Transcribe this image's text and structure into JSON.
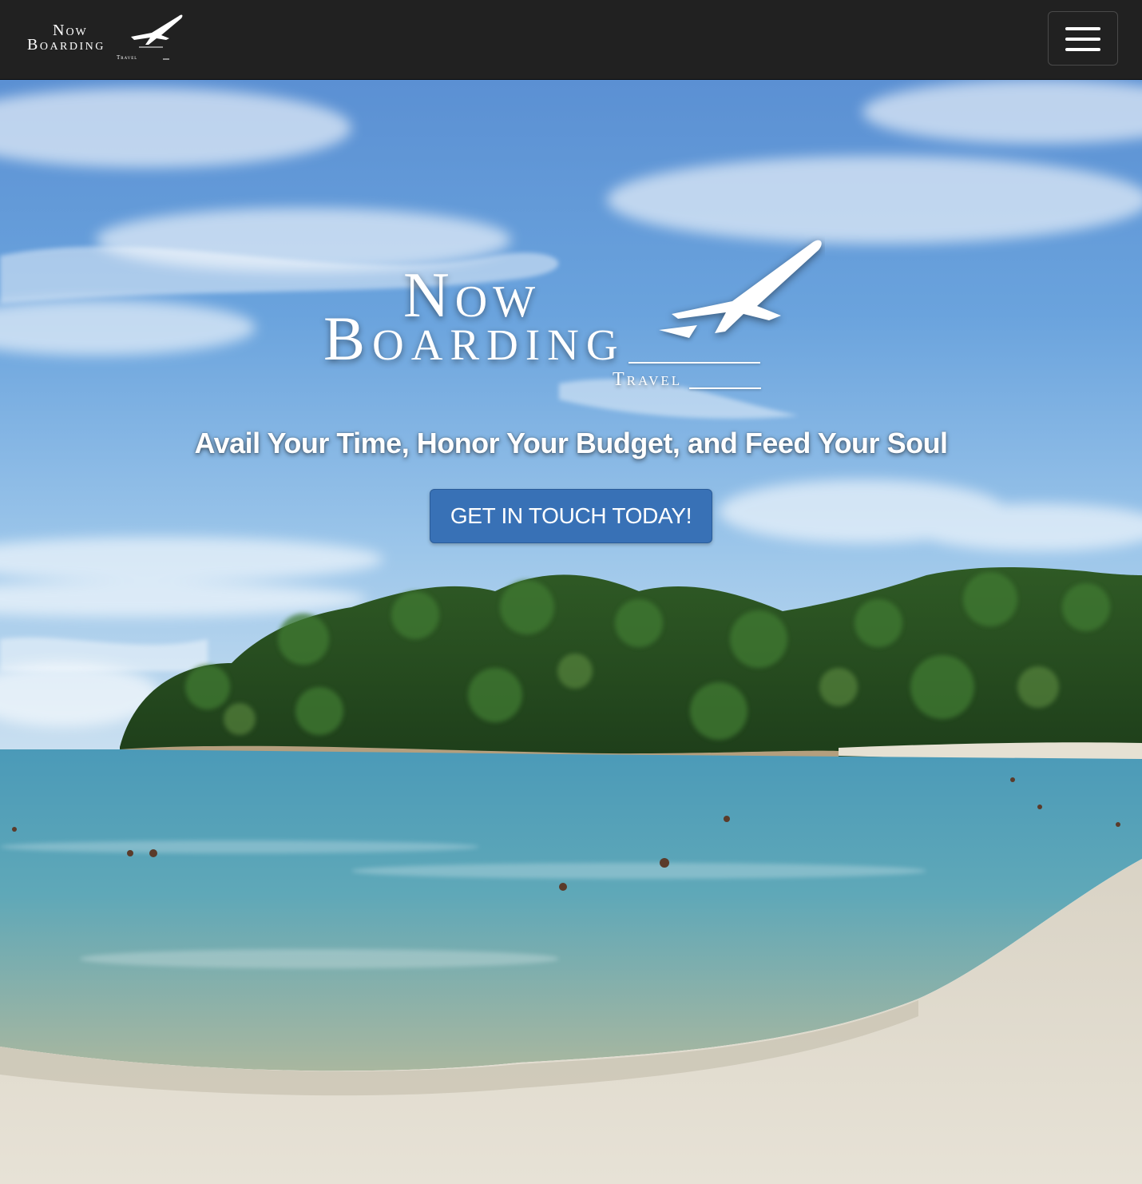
{
  "navbar": {
    "logo": {
      "line1": "Now",
      "line2": "Boarding",
      "line3": "Travel"
    },
    "menu_icon": "hamburger-menu-icon"
  },
  "hero": {
    "logo": {
      "line1": "Now",
      "line2": "Boarding",
      "line3": "Travel"
    },
    "tagline": "Avail Your Time, Honor Your Budget, and Feed Your Soul",
    "cta_label": "GET IN TOUCH TODAY!",
    "background": "beach-photo"
  },
  "colors": {
    "navbar_bg": "#212121",
    "cta_bg": "#3871b6",
    "text": "#ffffff"
  }
}
